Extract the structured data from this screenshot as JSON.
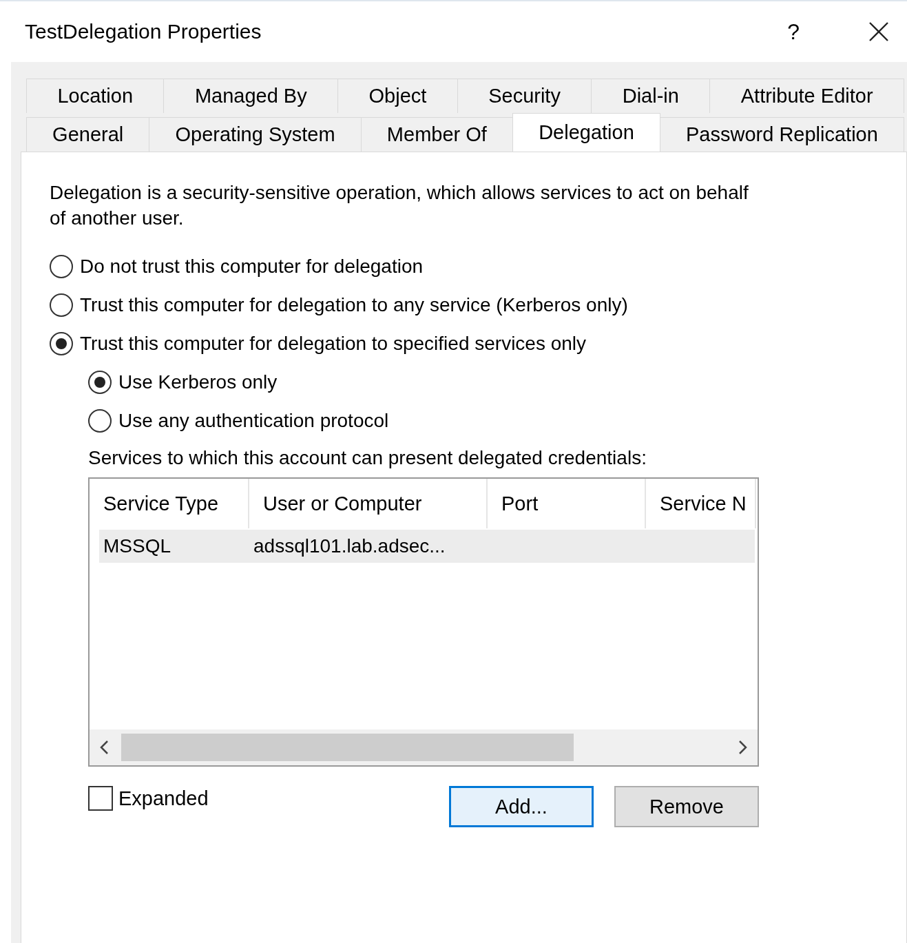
{
  "window": {
    "title": "TestDelegation Properties",
    "help": "?"
  },
  "tab_rows": [
    [
      {
        "label": "Location",
        "selected": false
      },
      {
        "label": "Managed By",
        "selected": false
      },
      {
        "label": "Object",
        "selected": false
      },
      {
        "label": "Security",
        "selected": false
      },
      {
        "label": "Dial-in",
        "selected": false
      },
      {
        "label": "Attribute Editor",
        "selected": false
      }
    ],
    [
      {
        "label": "General",
        "selected": false
      },
      {
        "label": "Operating System",
        "selected": false
      },
      {
        "label": "Member Of",
        "selected": false
      },
      {
        "label": "Delegation",
        "selected": true
      },
      {
        "label": "Password Replication",
        "selected": false
      }
    ]
  ],
  "description": "Delegation is a security-sensitive operation, which allows services to act on behalf of another user.",
  "delegation_options": [
    {
      "label": "Do not trust this computer for delegation",
      "selected": false
    },
    {
      "label": "Trust this computer for delegation to any service (Kerberos only)",
      "selected": false
    },
    {
      "label": "Trust this computer for delegation to specified services only",
      "selected": true,
      "children": [
        {
          "label": "Use Kerberos only",
          "selected": true
        },
        {
          "label": "Use any authentication protocol",
          "selected": false
        }
      ]
    }
  ],
  "services_label": "Services to which this account can present delegated credentials:",
  "services_table": {
    "columns": [
      "Service Type",
      "User or Computer",
      "Port",
      "Service N"
    ],
    "rows": [
      {
        "cells": [
          "MSSQL",
          "adssql101.lab.adsec...",
          "",
          ""
        ],
        "selected": true
      }
    ]
  },
  "expanded": {
    "label": "Expanded",
    "checked": false
  },
  "buttons": [
    {
      "label": "Add...",
      "focused": true
    },
    {
      "label": "Remove",
      "focused": false
    }
  ]
}
